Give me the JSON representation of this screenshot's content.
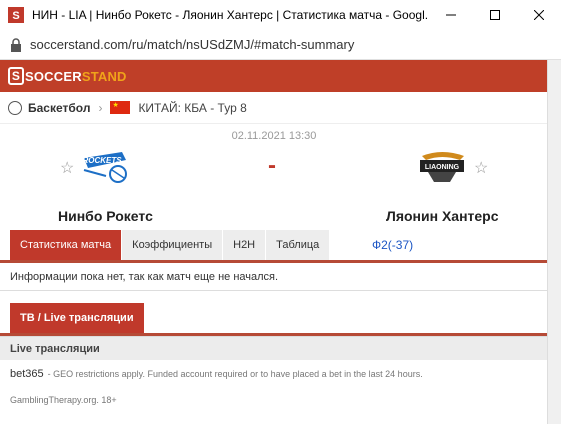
{
  "browser": {
    "title": "НИН - LIA | Нинбо Рокетс - Ляонин Хантерс | Статистика матча - Googl...",
    "url": "soccerstand.com/ru/match/nsUSdZMJ/#match-summary"
  },
  "site": {
    "logo_part1": "SOCCER",
    "logo_part2": "STAND",
    "logo_mark": "S",
    "colors": {
      "brand": "#bf3f28",
      "accent": "#f0a31a",
      "link": "#1b55c4"
    }
  },
  "breadcrumb": {
    "sport": "Баскетбол",
    "country_league": "КИТАЙ: КБА - Тур 8"
  },
  "match": {
    "date": "02.11.2021 13:30",
    "score_separator": "-",
    "home_team": "Нинбо Рокетс",
    "away_team": "Ляонин Хантерс",
    "home_logo_text": "ROCKETS",
    "away_logo_text": "LIAONING"
  },
  "tabs": [
    {
      "label": "Статистика матча",
      "active": true
    },
    {
      "label": "Коэффициенты",
      "active": false
    },
    {
      "label": "H2H",
      "active": false
    },
    {
      "label": "Таблица",
      "active": false
    }
  ],
  "odds_link": "Ф2(-37)",
  "info_text": "Информации пока нет, так как матч еще не начался.",
  "tv": {
    "tab_label": "ТВ / Live трансляции",
    "section_header": "Live трансляции",
    "bookmaker": "bet365",
    "bookmaker_note": "- GEO restrictions apply. Funded account required or to have placed a bet in the last 24 hours.",
    "gambling_note": "GamblingTherapy.org. 18+"
  }
}
